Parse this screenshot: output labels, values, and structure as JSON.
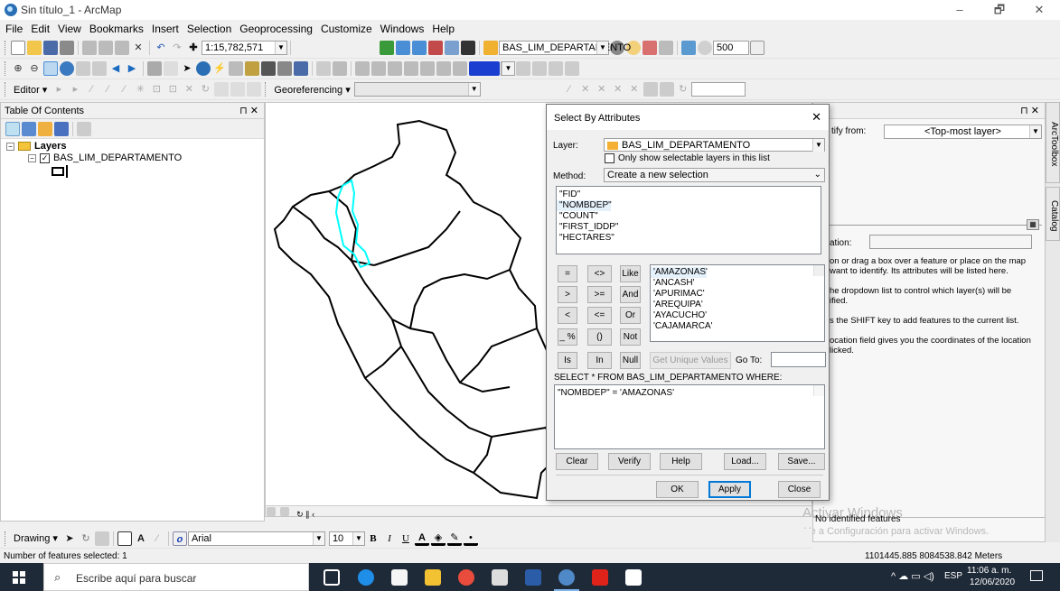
{
  "window": {
    "title": "Sin título_1 - ArcMap",
    "minimize_glyph": "–",
    "restore_glyph": "🗗",
    "close_glyph": "✕"
  },
  "menu": [
    "File",
    "Edit",
    "View",
    "Bookmarks",
    "Insert",
    "Selection",
    "Geoprocessing",
    "Customize",
    "Windows",
    "Help"
  ],
  "toolbar": {
    "scale": "1:15,782,571",
    "layer_combo": "BAS_LIM_DEPARTAMENTO",
    "zoom_value": "500",
    "editor_label": "Editor ▾",
    "georef_label": "Georeferencing ▾"
  },
  "toc": {
    "title": "Table Of Contents",
    "pin_glyph": "⊓ ✕",
    "root": "Layers",
    "layer": "BAS_LIM_DEPARTAMENTO"
  },
  "identify": {
    "title": "tify",
    "pin_glyph": "⊓ ✕",
    "from_label": "tify from:",
    "from_value": "<Top-most layer>",
    "location_label": "ation:",
    "help": [
      "on or drag a box over a feature or place on the map",
      "want to identify. Its attributes will be listed here.",
      "he dropdown list to control which layer(s) will be",
      "ified.",
      "s the SHIFT key to add features to the current list.",
      "ocation field gives you the coordinates of the location",
      "licked."
    ],
    "status": "No identified features",
    "watermark_1": "Activar Windows",
    "watermark_2": "Ve a Configuración para activar Windows."
  },
  "sidetabs": [
    "ArcToolbox",
    "Catalog"
  ],
  "dialog": {
    "title": "Select By Attributes",
    "close_glyph": "✕",
    "layer_label": "Layer:",
    "layer_value": "BAS_LIM_DEPARTAMENTO",
    "only_selectable": "Only show selectable layers in this list",
    "method_label": "Method:",
    "method_value": "Create a new selection",
    "fields": [
      "\"FID\"",
      "\"NOMBDEP\"",
      "\"COUNT\"",
      "\"FIRST_IDDP\"",
      "\"HECTARES\""
    ],
    "operators": [
      "=",
      "<>",
      "Like",
      ">",
      ">=",
      "And",
      "<",
      "<=",
      "Or",
      "_ %",
      "()",
      "Not",
      "Is",
      "In",
      "Null"
    ],
    "values": [
      "'AMAZONAS'",
      "'ANCASH'",
      "'APURIMAC'",
      "'AREQUIPA'",
      "'AYACUCHO'",
      "'CAJAMARCA'"
    ],
    "get_unique": "Get Unique Values",
    "goto_label": "Go To:",
    "where_label": "SELECT * FROM BAS_LIM_DEPARTAMENTO WHERE:",
    "expression": "\"NOMBDEP\" = 'AMAZONAS'",
    "btn_clear": "Clear",
    "btn_verify": "Verify",
    "btn_help": "Help",
    "btn_load": "Load...",
    "btn_save": "Save...",
    "btn_ok": "OK",
    "btn_apply": "Apply",
    "btn_close": "Close"
  },
  "drawing": {
    "label": "Drawing ▾",
    "font": "Arial",
    "size": "10"
  },
  "status": {
    "left": "Number of features selected: 1",
    "coords": "1101445.885 8084538.842 Meters"
  },
  "taskbar": {
    "search": "Escribe aquí para buscar",
    "lang": "ESP",
    "time": "11:06 a. m.",
    "date": "12/06/2020"
  }
}
